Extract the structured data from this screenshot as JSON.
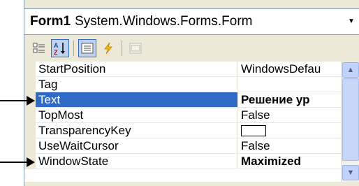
{
  "header": {
    "object_name": "Form1",
    "object_type": "System.Windows.Forms.Form"
  },
  "toolbar": {
    "icons": [
      "categorized-icon",
      "alphabetical-icon",
      "properties-icon",
      "events-icon",
      "property-pages-icon"
    ]
  },
  "properties": [
    {
      "name": "StartPosition",
      "value": "WindowsDefau"
    },
    {
      "name": "Tag",
      "value": ""
    },
    {
      "name": "Text",
      "value": "Решение ур"
    },
    {
      "name": "TopMost",
      "value": "False"
    },
    {
      "name": "TransparencyKey",
      "value": ""
    },
    {
      "name": "UseWaitCursor",
      "value": "False"
    },
    {
      "name": "WindowState",
      "value": "Maximized"
    }
  ],
  "colors": {
    "selection": "#316ac5",
    "panel_bg": "#ece9d8"
  }
}
